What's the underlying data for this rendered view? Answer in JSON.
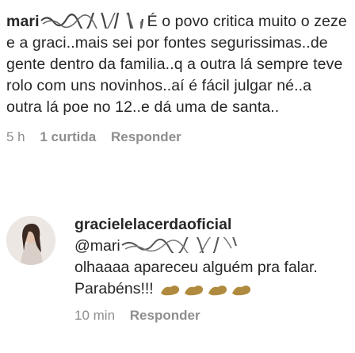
{
  "main_comment": {
    "username": "mari",
    "text": "É o povo critica muito o zeze e a graci..mais sei por fontes segurissimas..de gente dentro da familia..q a outra lá sempre teve rolo com uns novinhos..aí é fácil julgar né..a outra lá poe no 12..e dá uma de santa..",
    "time": "5 h",
    "likes": "1 curtida",
    "reply_label": "Responder"
  },
  "reply_comment": {
    "username": "gracielelacerdaoficial",
    "mention": "@mari",
    "text": "olhaaaa apareceu alguém pra falar. Parabéns!!!",
    "emoji_count": 4,
    "time": "10 min",
    "reply_label": "Responder"
  }
}
